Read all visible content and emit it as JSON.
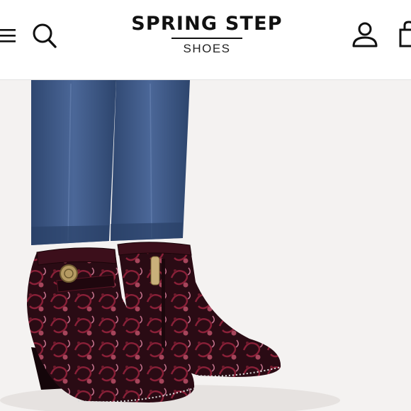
{
  "header": {
    "brand_name": "SPRING STEP",
    "brand_sub": "SHOES",
    "icons": [
      "menu-icon",
      "search-icon",
      "account-icon",
      "shopping-bag-icon"
    ]
  },
  "hero": {
    "subject": "product-photo-ankle-boots"
  },
  "colors": {
    "header_bg": "#ffffff",
    "text": "#111111",
    "divider": "#e2e2e2",
    "denim": "#3f5a86",
    "boot_base": "#2a0b14",
    "boot_pattern": "#8a2038"
  }
}
